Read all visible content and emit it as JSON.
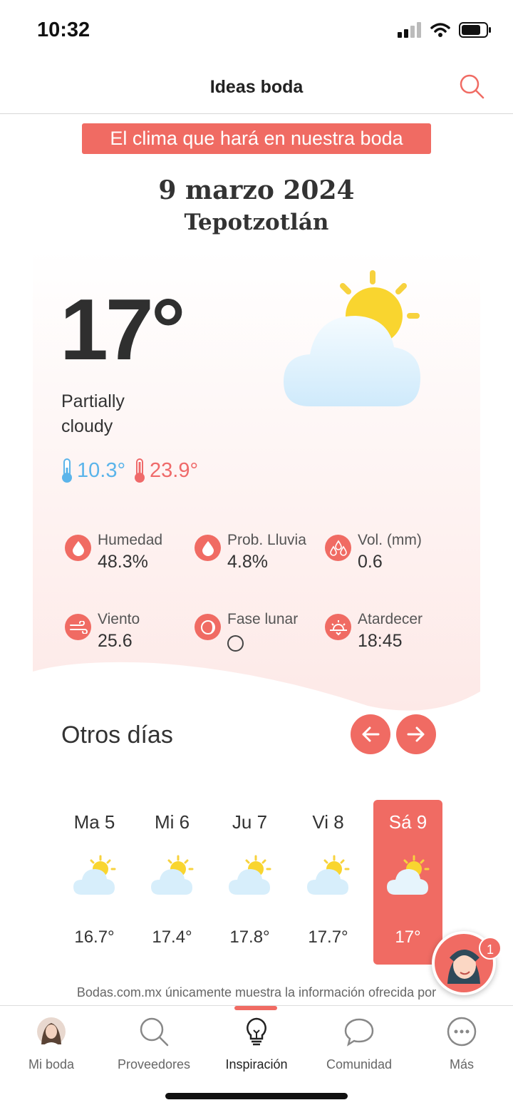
{
  "status_bar": {
    "time": "10:32"
  },
  "header": {
    "title": "Ideas boda"
  },
  "banner": {
    "text": "El clima que hará en nuestra boda"
  },
  "event": {
    "date": "9 marzo 2024",
    "place": "Tepotzotlán"
  },
  "weather": {
    "temperature": "17°",
    "condition": "Partially cloudy",
    "min": "10.3°",
    "max": "23.9°",
    "icon": "partly-cloudy-icon"
  },
  "stats": {
    "humidity": {
      "label": "Humedad",
      "value": "48.3%",
      "icon": "droplet-icon"
    },
    "rain_prob": {
      "label": "Prob. Lluvia",
      "value": "4.8%",
      "icon": "droplet-icon"
    },
    "volume": {
      "label": "Vol. (mm)",
      "value": "0.6",
      "icon": "rain-drops-icon"
    },
    "wind": {
      "label": "Viento",
      "value": "25.6",
      "icon": "wind-icon"
    },
    "moon": {
      "label": "Fase lunar",
      "icon": "moon-phase-icon"
    },
    "sunset": {
      "label": "Atardecer",
      "value": "18:45",
      "icon": "sunset-icon"
    }
  },
  "other_days": {
    "title": "Otros días",
    "days": [
      {
        "name": "Ma 5",
        "temp": "16.7°"
      },
      {
        "name": "Mi 6",
        "temp": "17.4°"
      },
      {
        "name": "Ju 7",
        "temp": "17.8°"
      },
      {
        "name": "Vi 8",
        "temp": "17.7°"
      },
      {
        "name": "Sá 9",
        "temp": "17°",
        "selected": true
      }
    ]
  },
  "disclaimer": "Bodas.com.mx únicamente muestra la información ofrecida por",
  "chat": {
    "badge": "1"
  },
  "tabs": [
    {
      "label": "Mi boda",
      "icon": "avatar-icon"
    },
    {
      "label": "Proveedores",
      "icon": "search-icon"
    },
    {
      "label": "Inspiración",
      "icon": "lightbulb-icon",
      "active": true
    },
    {
      "label": "Comunidad",
      "icon": "chat-bubble-icon"
    },
    {
      "label": "Más",
      "icon": "more-icon"
    }
  ],
  "colors": {
    "accent": "#f06b63",
    "min_temp": "#5bb4ea",
    "max_temp": "#ef6a6a"
  }
}
